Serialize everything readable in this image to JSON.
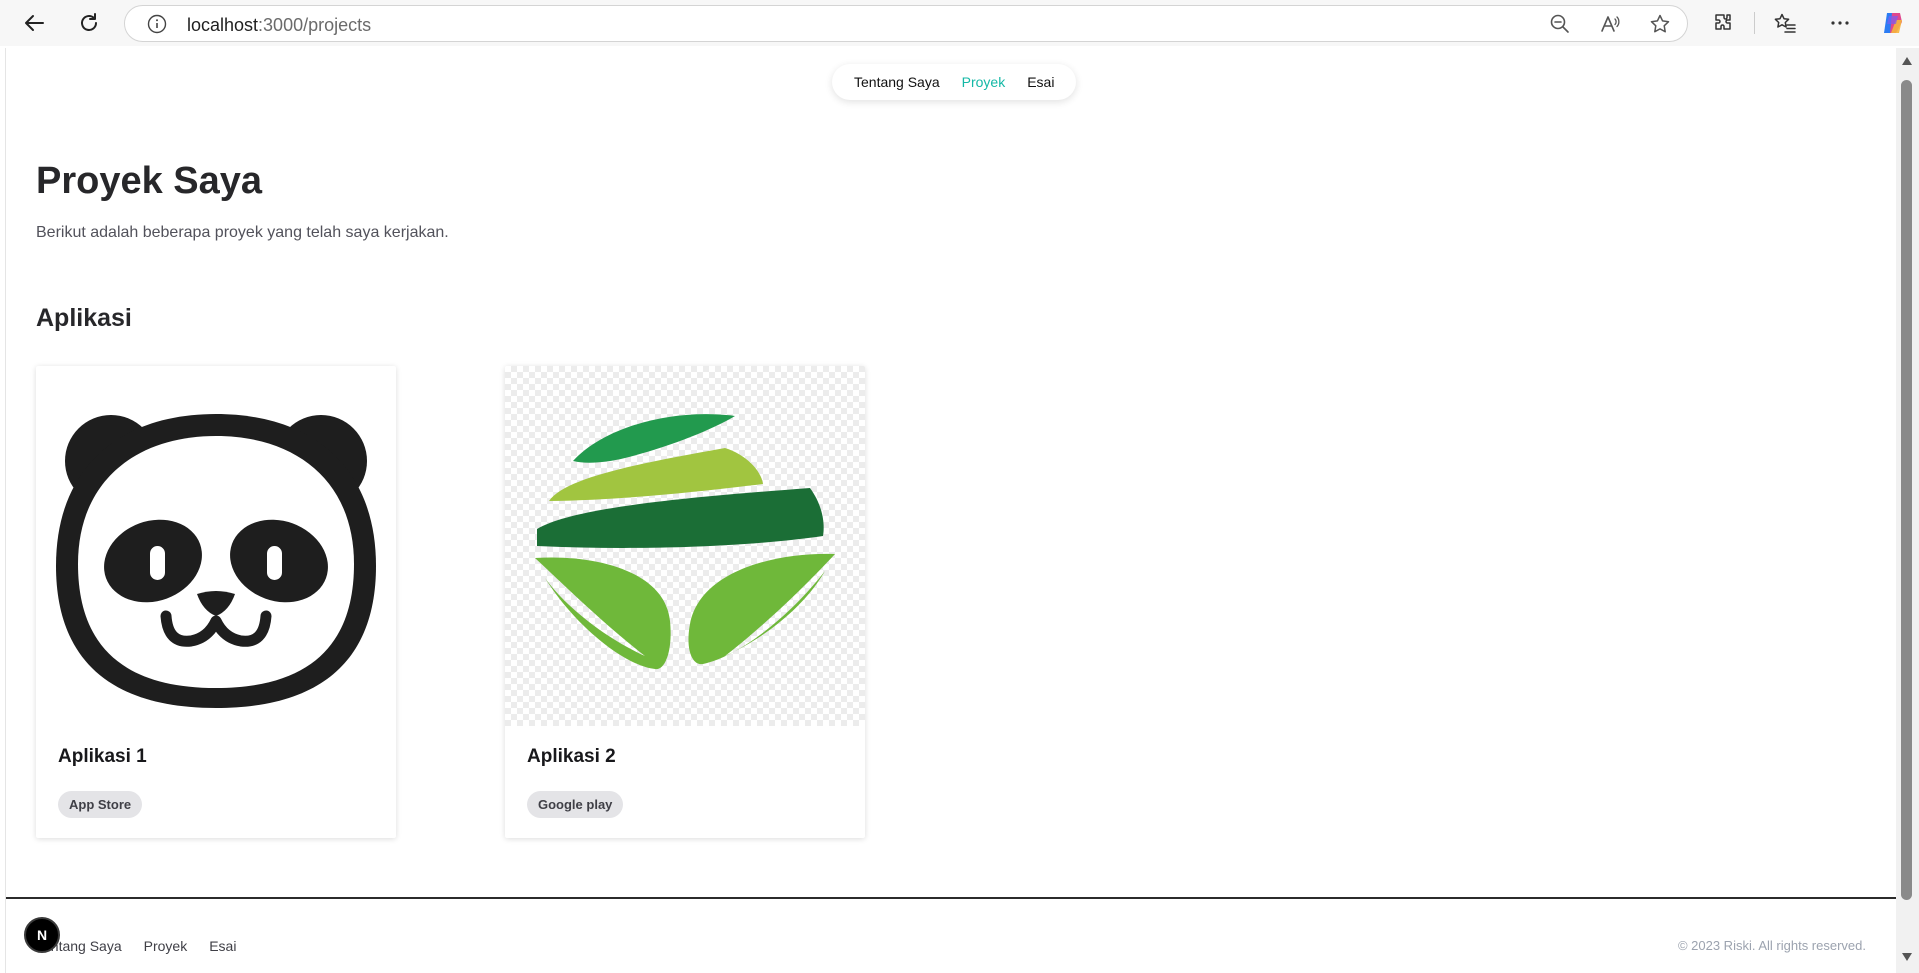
{
  "browser": {
    "url_host": "localhost",
    "url_path": ":3000/projects"
  },
  "nav": {
    "items": [
      "Tentang Saya",
      "Proyek",
      "Esai"
    ],
    "active": "Proyek"
  },
  "page": {
    "title": "Proyek Saya",
    "subtitle": "Berikut adalah beberapa proyek yang telah saya kerjakan.",
    "section_title": "Aplikasi"
  },
  "cards": [
    {
      "title": "Aplikasi 1",
      "tag": "App Store",
      "image": "panda-logo"
    },
    {
      "title": "Aplikasi 2",
      "tag": "Google play",
      "image": "green-leaf-logo"
    }
  ],
  "footer": {
    "links": [
      "Tentang Saya",
      "Proyek",
      "Esai"
    ],
    "copyright": "© 2023 Riski. All rights reserved.",
    "badge": "N"
  },
  "colors": {
    "accent": "#14b8a6",
    "leaf_dark": "#1b6e36",
    "leaf_mid": "#229a4e",
    "leaf_light": "#a1c540",
    "leaf_bright": "#6fb83a"
  }
}
